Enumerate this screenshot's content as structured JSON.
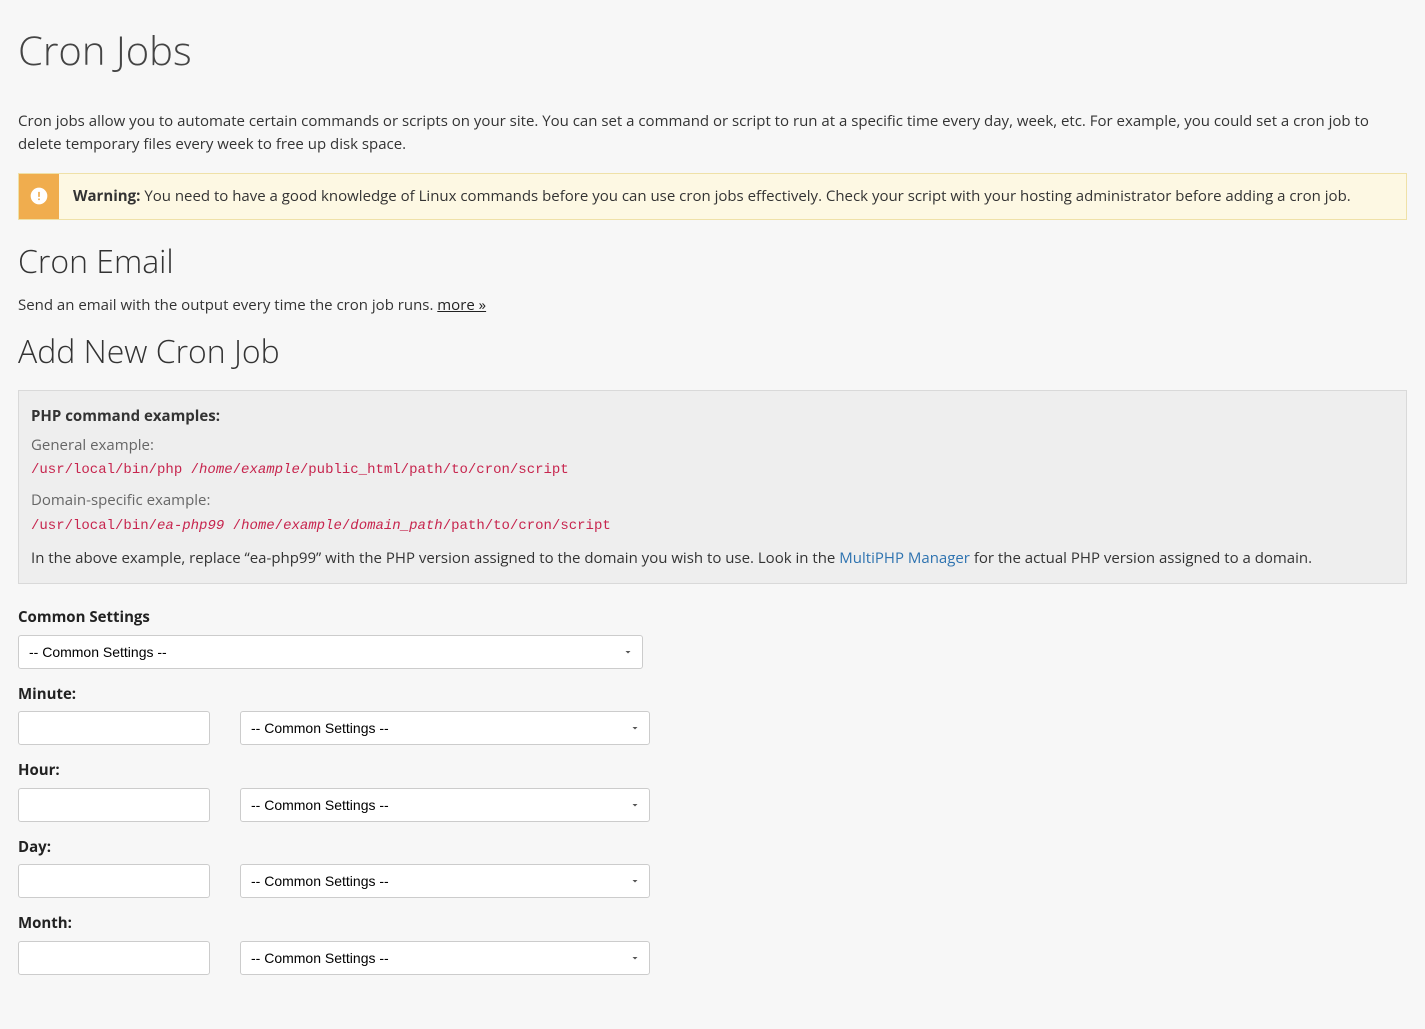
{
  "page_title": "Cron Jobs",
  "intro": "Cron jobs allow you to automate certain commands or scripts on your site. You can set a command or script to run at a specific time every day, week, etc. For example, you could set a cron job to delete temporary files every week to free up disk space.",
  "warning": {
    "label": "Warning:",
    "text": " You need to have a good knowledge of Linux commands before you can use cron jobs effectively. Check your script with your hosting administrator before adding a cron job."
  },
  "cron_email": {
    "heading": "Cron Email",
    "text": "Send an email with the output every time the cron job runs. ",
    "more": "more »"
  },
  "add_new_heading": "Add New Cron Job",
  "examples": {
    "title": "PHP command examples:",
    "general_label": "General example:",
    "general_code": {
      "p1": "/usr/local/bin/php /",
      "p2_i": "home",
      "p3": "/",
      "p4_i": "example",
      "p5": "/public_html/path/to/cron/script"
    },
    "domain_label": "Domain-specific example:",
    "domain_code": {
      "p1": "/usr/local/bin/",
      "p2_i": "ea-php99",
      "p3": " /",
      "p4_i": "home",
      "p5": "/",
      "p6_i": "example",
      "p7": "/",
      "p8_i": "domain_path",
      "p9": "/path/to/cron/script"
    },
    "explain_before": "In the above example, replace “ea-php99” with the PHP version assigned to the domain you wish to use. Look in the ",
    "explain_link": "MultiPHP Manager",
    "explain_after": " for the actual PHP version assigned to a domain."
  },
  "form": {
    "common_settings_label": "Common Settings",
    "common_settings_option": "-- Common Settings --",
    "minute_label": "Minute:",
    "hour_label": "Hour:",
    "day_label": "Day:",
    "month_label": "Month:",
    "row_option": "-- Common Settings --",
    "minute_value": "",
    "hour_value": "",
    "day_value": "",
    "month_value": ""
  }
}
